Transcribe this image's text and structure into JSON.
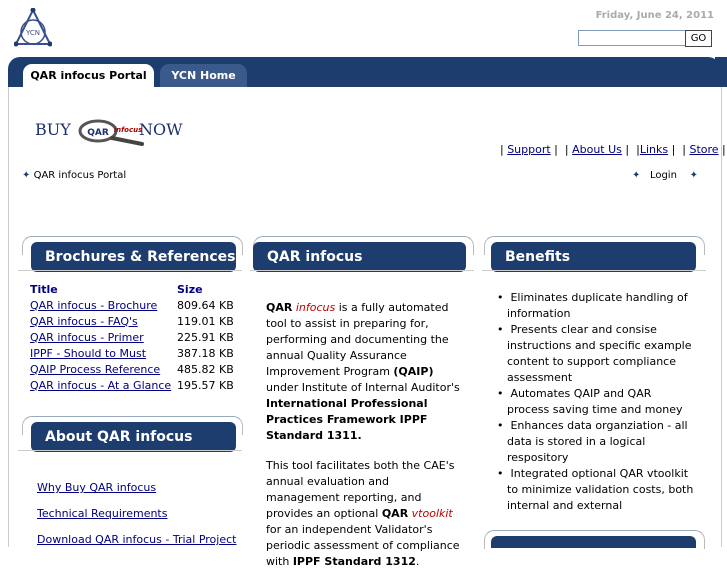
{
  "header": {
    "logo_text": "YCN",
    "date": "Friday, June 24, 2011",
    "search": {
      "value": "",
      "placeholder": ""
    },
    "go_label": "GO"
  },
  "tabs": [
    {
      "label": "QAR infocus Portal",
      "active": true
    },
    {
      "label": "YCN Home",
      "active": false
    }
  ],
  "banner": {
    "buy": "BUY",
    "logo_mid": "QAR",
    "logo_brand": "infocus",
    "now": "NOW"
  },
  "top_links": [
    "Support",
    "About Us",
    "Links",
    "Store"
  ],
  "breadcrumb": "QAR infocus Portal",
  "login_label": "Login",
  "brochures": {
    "heading": "Brochures & References",
    "col_title": "Title",
    "col_size": "Size",
    "rows": [
      {
        "title": "QAR infocus - Brochure",
        "size": "809.64 KB"
      },
      {
        "title": "QAR infocus - FAQ's",
        "size": "119.01 KB"
      },
      {
        "title": "QAR infocus - Primer",
        "size": "225.91 KB"
      },
      {
        "title": "IPPF - Should to Must",
        "size": "387.18 KB"
      },
      {
        "title": "QAIP Process Reference",
        "size": "485.82 KB"
      },
      {
        "title": "QAR infocus - At a Glance",
        "size": "195.57 KB"
      }
    ]
  },
  "about": {
    "heading": "About QAR infocus",
    "links": [
      "Why Buy QAR infocus",
      "Technical Requirements",
      "Download QAR infocus - Trial Project"
    ]
  },
  "main": {
    "heading": "QAR infocus",
    "p1": {
      "qar": "QAR",
      "infocus": "infocus",
      "t1": " is a fully automated tool to assist in preparing for, performing and documenting the annual Quality Assurance Improvement Program ",
      "qaip": "(QAIP)",
      "t2": " under Institute of Internal Auditor's ",
      "ippf": "International Professional Practices Framework IPPF Standard 1311."
    },
    "p2": {
      "t1": "This tool facilitates both the CAE's annual evaluation  and management reporting, and provides an optional ",
      "qar": "QAR",
      "vtoolkit": "vtoolkit",
      "t2": " for an independent Validator's periodic assessment of compliance with ",
      "std": "IPPF Standard 1312",
      "t3": "."
    }
  },
  "benefits": {
    "heading": "Benefits",
    "items": [
      "Eliminates duplicate handling of information",
      "Presents clear and consise instructions and specific example content to support compliance assessment",
      "Automates QAIP and QAR process saving time and money",
      "Enhances data organziation - all data is stored in a logical respository",
      "Integrated optional QAR vtoolkit to minimize validation costs, both internal and external"
    ]
  },
  "colors": {
    "nav_blue": "#1e3d6f",
    "link": "#000080",
    "accent_red": "#b00000"
  }
}
